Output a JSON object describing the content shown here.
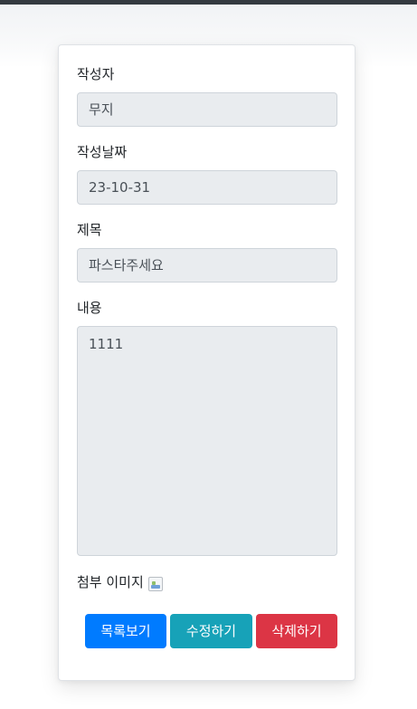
{
  "form": {
    "writer_label": "작성자",
    "writer_value": "무지",
    "date_label": "작성날짜",
    "date_value": "23-10-31",
    "title_label": "제목",
    "title_value": "파스타주세요",
    "content_label": "내용",
    "content_value": "1111",
    "attachment_label": "첨부 이미지"
  },
  "buttons": {
    "list": "목록보기",
    "edit": "수정하기",
    "delete": "삭제하기"
  },
  "colors": {
    "primary": "#007bff",
    "info": "#17a2b8",
    "danger": "#dc3545",
    "field_bg": "#e9ecef"
  }
}
